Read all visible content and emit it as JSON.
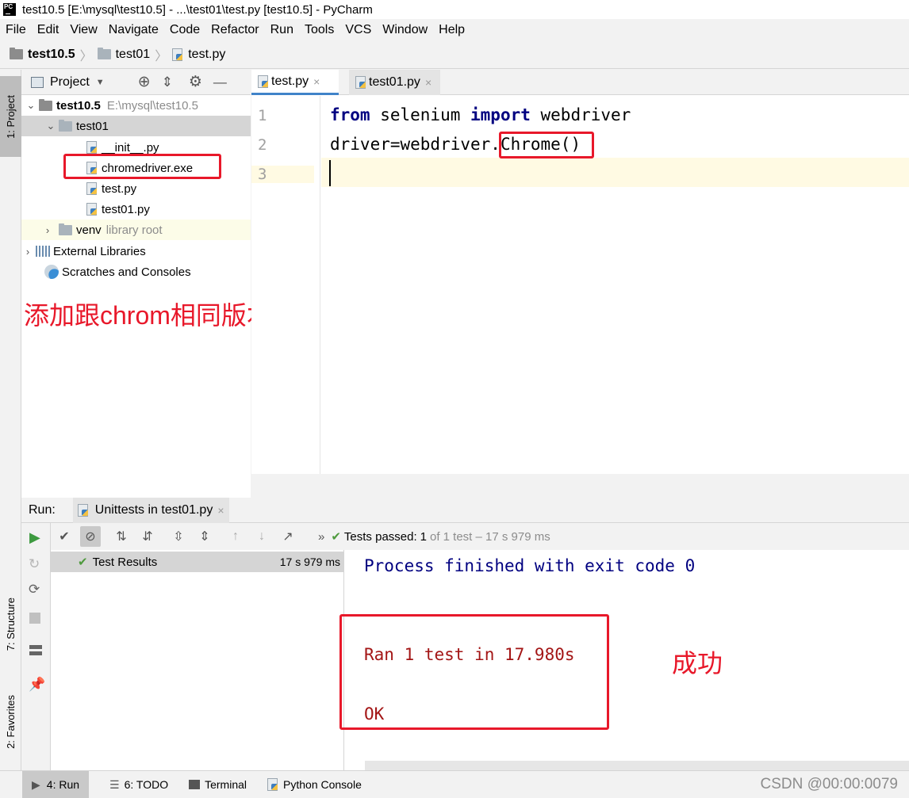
{
  "window": {
    "title": "test10.5 [E:\\mysql\\test10.5] - ...\\test01\\test.py [test10.5] - PyCharm",
    "logo": "PC"
  },
  "menu": [
    "File",
    "Edit",
    "View",
    "Navigate",
    "Code",
    "Refactor",
    "Run",
    "Tools",
    "VCS",
    "Window",
    "Help"
  ],
  "breadcrumb": [
    "test10.5",
    "test01",
    "test.py"
  ],
  "left_strip": {
    "project_tab": "1: Project",
    "structure_tab": "7: Structure",
    "favorites_tab": "2: Favorites"
  },
  "project": {
    "header": "Project",
    "root": {
      "name": "test10.5",
      "path": "E:\\mysql\\test10.5"
    },
    "folder": "test01",
    "files": [
      "__init__.py",
      "chromedriver.exe",
      "test.py",
      "test01.py"
    ],
    "venv": {
      "name": "venv",
      "hint": "library root"
    },
    "external": "External Libraries",
    "scratches": "Scratches and Consoles"
  },
  "editor": {
    "tabs": [
      "test.py",
      "test01.py"
    ],
    "line_numbers": [
      "1",
      "2",
      "3"
    ],
    "line1": {
      "kw1": "from",
      "mod": " selenium ",
      "kw2": "import",
      "rest": " webdriver"
    },
    "line2": {
      "pre": "driver=webdriver.",
      "call": "Chrome()"
    }
  },
  "run": {
    "label": "Run:",
    "tab": "Unittests in test01.py",
    "status_prefix": "Tests passed:",
    "status_count": "1",
    "status_rest": "of 1 test – 17 s 979 ms",
    "result_label": "Test Results",
    "result_time": "17 s 979 ms",
    "console": {
      "finished": "Process finished with exit code 0",
      "ran": "Ran 1 test in 17.980s",
      "ok": "OK"
    }
  },
  "annotations": {
    "driver_note": "添加跟chrom相同版本的驱动",
    "success_note": "成功"
  },
  "bottom_tabs": {
    "run": "4: Run",
    "todo": "6: TODO",
    "terminal": "Terminal",
    "python_console": "Python Console"
  },
  "watermark": "CSDN @00:00:0079",
  "colors": {
    "annotation_red": "#e8182a",
    "keyword": "#000080",
    "console_blue": "#000080",
    "console_red": "#a31515",
    "pass_green": "#4e9a3d",
    "caret_line": "#fffae3"
  }
}
